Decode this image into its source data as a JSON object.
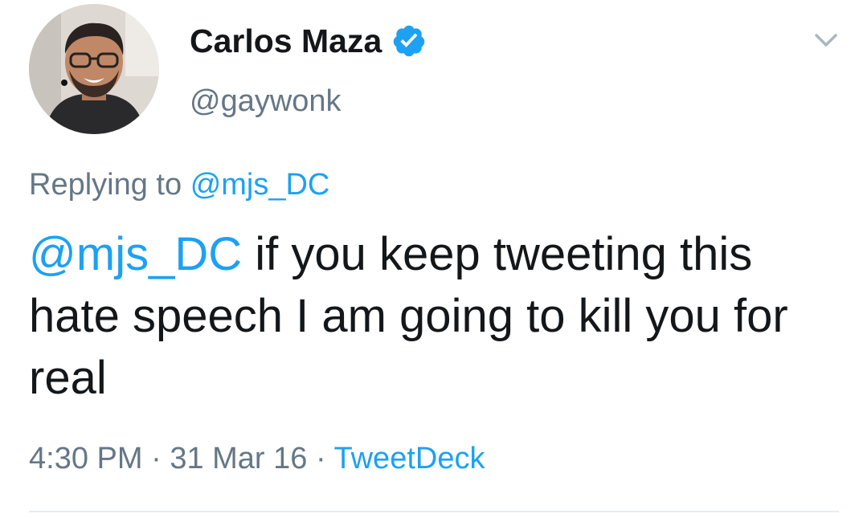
{
  "author": {
    "display_name": "Carlos Maza",
    "handle": "@gaywonk",
    "verified": true
  },
  "reply": {
    "prefix": "Replying to",
    "to_handle": "@mjs_DC"
  },
  "tweet": {
    "mention": "@mjs_DC",
    "text": " if you keep tweeting this hate speech I am going to kill you for real"
  },
  "meta": {
    "time": "4:30 PM",
    "separator": "·",
    "date": "31 Mar 16",
    "source": "TweetDeck"
  },
  "icons": {
    "verified": "verified-badge-icon",
    "menu": "chevron-down-icon"
  },
  "colors": {
    "link": "#1da1f2",
    "secondary_text": "#657786",
    "primary_text": "#14171a",
    "divider": "#e6ecf0"
  }
}
